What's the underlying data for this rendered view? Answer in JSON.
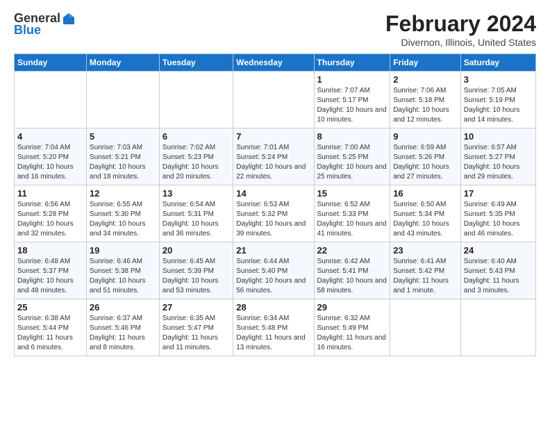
{
  "header": {
    "logo_general": "General",
    "logo_blue": "Blue",
    "title": "February 2024",
    "subtitle": "Divernon, Illinois, United States"
  },
  "days_of_week": [
    "Sunday",
    "Monday",
    "Tuesday",
    "Wednesday",
    "Thursday",
    "Friday",
    "Saturday"
  ],
  "weeks": [
    [
      {
        "day": "",
        "info": ""
      },
      {
        "day": "",
        "info": ""
      },
      {
        "day": "",
        "info": ""
      },
      {
        "day": "",
        "info": ""
      },
      {
        "day": "1",
        "sunrise": "7:07 AM",
        "sunset": "5:17 PM",
        "daylight": "10 hours and 10 minutes."
      },
      {
        "day": "2",
        "sunrise": "7:06 AM",
        "sunset": "5:18 PM",
        "daylight": "10 hours and 12 minutes."
      },
      {
        "day": "3",
        "sunrise": "7:05 AM",
        "sunset": "5:19 PM",
        "daylight": "10 hours and 14 minutes."
      }
    ],
    [
      {
        "day": "4",
        "sunrise": "7:04 AM",
        "sunset": "5:20 PM",
        "daylight": "10 hours and 16 minutes."
      },
      {
        "day": "5",
        "sunrise": "7:03 AM",
        "sunset": "5:21 PM",
        "daylight": "10 hours and 18 minutes."
      },
      {
        "day": "6",
        "sunrise": "7:02 AM",
        "sunset": "5:23 PM",
        "daylight": "10 hours and 20 minutes."
      },
      {
        "day": "7",
        "sunrise": "7:01 AM",
        "sunset": "5:24 PM",
        "daylight": "10 hours and 22 minutes."
      },
      {
        "day": "8",
        "sunrise": "7:00 AM",
        "sunset": "5:25 PM",
        "daylight": "10 hours and 25 minutes."
      },
      {
        "day": "9",
        "sunrise": "6:59 AM",
        "sunset": "5:26 PM",
        "daylight": "10 hours and 27 minutes."
      },
      {
        "day": "10",
        "sunrise": "6:57 AM",
        "sunset": "5:27 PM",
        "daylight": "10 hours and 29 minutes."
      }
    ],
    [
      {
        "day": "11",
        "sunrise": "6:56 AM",
        "sunset": "5:28 PM",
        "daylight": "10 hours and 32 minutes."
      },
      {
        "day": "12",
        "sunrise": "6:55 AM",
        "sunset": "5:30 PM",
        "daylight": "10 hours and 34 minutes."
      },
      {
        "day": "13",
        "sunrise": "6:54 AM",
        "sunset": "5:31 PM",
        "daylight": "10 hours and 36 minutes."
      },
      {
        "day": "14",
        "sunrise": "6:53 AM",
        "sunset": "5:32 PM",
        "daylight": "10 hours and 39 minutes."
      },
      {
        "day": "15",
        "sunrise": "6:52 AM",
        "sunset": "5:33 PM",
        "daylight": "10 hours and 41 minutes."
      },
      {
        "day": "16",
        "sunrise": "6:50 AM",
        "sunset": "5:34 PM",
        "daylight": "10 hours and 43 minutes."
      },
      {
        "day": "17",
        "sunrise": "6:49 AM",
        "sunset": "5:35 PM",
        "daylight": "10 hours and 46 minutes."
      }
    ],
    [
      {
        "day": "18",
        "sunrise": "6:48 AM",
        "sunset": "5:37 PM",
        "daylight": "10 hours and 48 minutes."
      },
      {
        "day": "19",
        "sunrise": "6:46 AM",
        "sunset": "5:38 PM",
        "daylight": "10 hours and 51 minutes."
      },
      {
        "day": "20",
        "sunrise": "6:45 AM",
        "sunset": "5:39 PM",
        "daylight": "10 hours and 53 minutes."
      },
      {
        "day": "21",
        "sunrise": "6:44 AM",
        "sunset": "5:40 PM",
        "daylight": "10 hours and 56 minutes."
      },
      {
        "day": "22",
        "sunrise": "6:42 AM",
        "sunset": "5:41 PM",
        "daylight": "10 hours and 58 minutes."
      },
      {
        "day": "23",
        "sunrise": "6:41 AM",
        "sunset": "5:42 PM",
        "daylight": "11 hours and 1 minute."
      },
      {
        "day": "24",
        "sunrise": "6:40 AM",
        "sunset": "5:43 PM",
        "daylight": "11 hours and 3 minutes."
      }
    ],
    [
      {
        "day": "25",
        "sunrise": "6:38 AM",
        "sunset": "5:44 PM",
        "daylight": "11 hours and 6 minutes."
      },
      {
        "day": "26",
        "sunrise": "6:37 AM",
        "sunset": "5:46 PM",
        "daylight": "11 hours and 8 minutes."
      },
      {
        "day": "27",
        "sunrise": "6:35 AM",
        "sunset": "5:47 PM",
        "daylight": "11 hours and 11 minutes."
      },
      {
        "day": "28",
        "sunrise": "6:34 AM",
        "sunset": "5:48 PM",
        "daylight": "11 hours and 13 minutes."
      },
      {
        "day": "29",
        "sunrise": "6:32 AM",
        "sunset": "5:49 PM",
        "daylight": "11 hours and 16 minutes."
      },
      {
        "day": "",
        "info": ""
      },
      {
        "day": "",
        "info": ""
      }
    ]
  ]
}
